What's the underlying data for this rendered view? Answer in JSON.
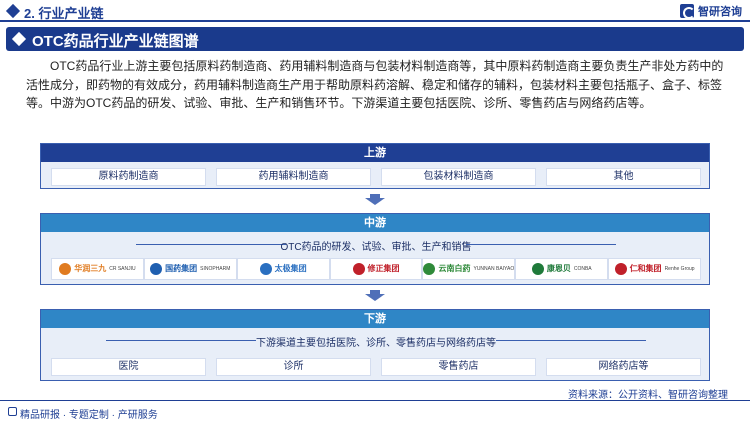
{
  "header": {
    "section_title": "2. 行业产业链",
    "brand_name": "智研咨询"
  },
  "banner": {
    "title": "OTC药品行业产业链图谱"
  },
  "intro": "OTC药品行业上游主要包括原料药制造商、药用辅料制造商与包装材料制造商等，其中原料药制造商主要负责生产非处方药中的活性成分，即药物的有效成分，药用辅料制造商生产用于帮助原料药溶解、稳定和储存的辅料，包装材料主要包括瓶子、盒子、标签等。中游为OTC药品的研发、试验、审批、生产和销售环节。下游渠道主要包括医院、诊所、零售药店与网络药店等。",
  "upstream": {
    "title": "上游",
    "items": [
      "原料药制造商",
      "药用辅料制造商",
      "包装材料制造商",
      "其他"
    ]
  },
  "midstream": {
    "title": "中游",
    "subtitle": "OTC药品的研发、试验、审批、生产和销售",
    "companies": [
      {
        "name": "华润三九",
        "sub": "CR SANJIU",
        "icon": "cr-sanjiu-logo",
        "color": "#e07b20"
      },
      {
        "name": "国药集团",
        "sub": "SINOPHARM",
        "icon": "sinopharm-logo",
        "color": "#1f5fb0"
      },
      {
        "name": "太极集团",
        "sub": "",
        "icon": "taiji-logo",
        "color": "#2a6fc0"
      },
      {
        "name": "修正集团",
        "sub": "",
        "icon": "xiuzheng-logo",
        "color": "#c0202a"
      },
      {
        "name": "云南白药",
        "sub": "YUNNAN BAIYAO",
        "icon": "yunnan-baiyao-logo",
        "color": "#2f8a3a"
      },
      {
        "name": "康恩贝",
        "sub": "CONBA",
        "icon": "conba-logo",
        "color": "#1f7a3a"
      },
      {
        "name": "仁和集团",
        "sub": "Renhe Group",
        "icon": "renhe-logo",
        "color": "#c0202a"
      }
    ]
  },
  "downstream": {
    "title": "下游",
    "subtitle": "下游渠道主要包括医院、诊所、零售药店与网络药店等",
    "items": [
      "医院",
      "诊所",
      "零售药店",
      "网络药店等"
    ]
  },
  "source": "资料来源：公开资料、智研咨询整理",
  "footer": {
    "tagline": "精品研报 · 专题定制 · 产研服务"
  }
}
